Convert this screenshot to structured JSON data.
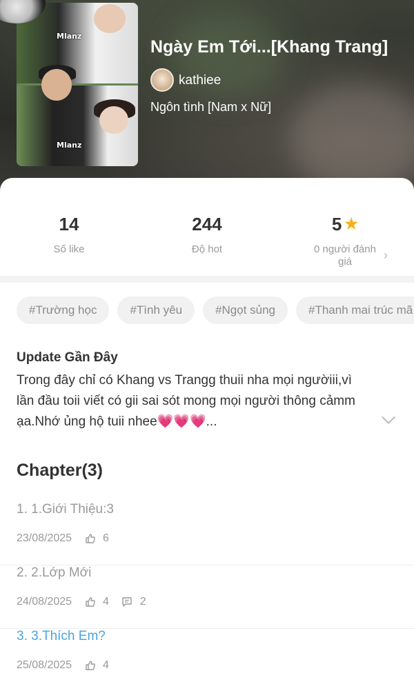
{
  "header": {
    "title": "Ngày Em Tới...[Khang Trang]",
    "author": "kathiee",
    "genre": "Ngôn tình [Nam x Nữ]",
    "cover_watermark": "Mlanz"
  },
  "stats": {
    "likes": {
      "value": "14",
      "label": "Số like"
    },
    "hot": {
      "value": "244",
      "label": "Độ hot"
    },
    "rating": {
      "value": "5",
      "label": "0 người đánh giá"
    }
  },
  "tags": [
    "#Trường học",
    "#Tình yêu",
    "#Ngọt sủng",
    "#Thanh mai trúc mã"
  ],
  "update": {
    "title": "Update Gần Đây",
    "body": "Trong đây chỉ có Khang vs Trangg thuii nha mọi ngườiii,vì lần đầu toii viết có gii sai sót mong mọi người thông cảmm ạa.Nhớ ủng hộ tuii nhee💗💗💗..."
  },
  "chapters_heading": "Chapter(3)",
  "chapters": [
    {
      "title": "1. 1.Giới Thiệu:3",
      "date": "23/08/2025",
      "likes": "6",
      "comments": ""
    },
    {
      "title": "2. 2.Lớp Mới",
      "date": "24/08/2025",
      "likes": "4",
      "comments": "2"
    },
    {
      "title": "3. 3.Thích Em?",
      "date": "25/08/2025",
      "likes": "4",
      "comments": ""
    }
  ],
  "colors": {
    "accent": "#4aa3df",
    "star": "#f2b21c"
  },
  "icons": [
    "thumb-up-icon",
    "comment-icon",
    "star-icon",
    "chevron-right-icon",
    "chevron-down-icon"
  ]
}
